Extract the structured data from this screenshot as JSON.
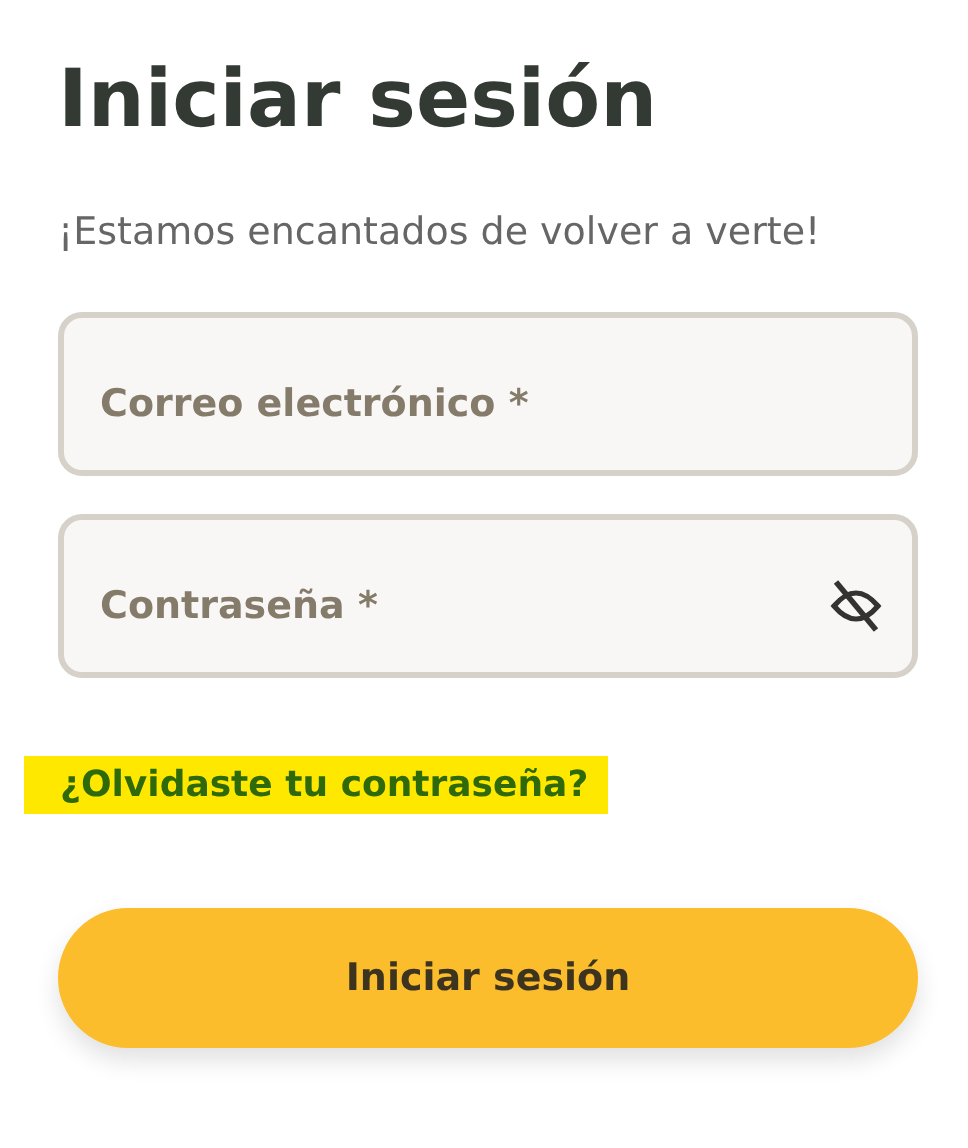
{
  "title": "Iniciar sesión",
  "subtitle": "¡Estamos encantados de volver a verte!",
  "fields": [
    {
      "kind": "email",
      "placeholder": "Correo electrónico *"
    },
    {
      "kind": "password",
      "placeholder": "Contraseña *"
    }
  ],
  "forgot_link": {
    "label": "¿Olvidaste tu contraseña?",
    "highlighted": true
  },
  "submit_button": {
    "label": "Iniciar sesión"
  }
}
